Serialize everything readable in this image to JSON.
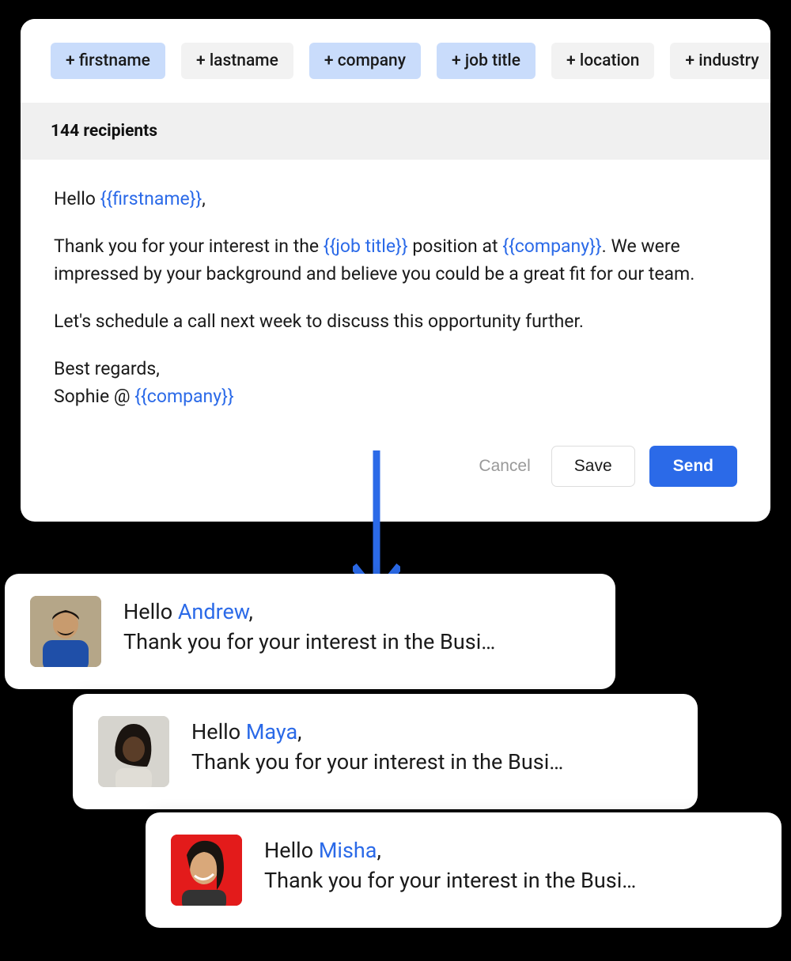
{
  "chips": [
    {
      "label": "+ firstname",
      "active": true
    },
    {
      "label": "+ lastname",
      "active": false
    },
    {
      "label": "+ company",
      "active": true
    },
    {
      "label": "+ job title",
      "active": true
    },
    {
      "label": "+ location",
      "active": false
    },
    {
      "label": "+ industry",
      "active": false
    }
  ],
  "recipients_label": "144 recipients",
  "body": {
    "greeting_prefix": "Hello ",
    "greeting_tag": "{{firstname}}",
    "greeting_suffix": ",",
    "para1_a": "Thank you for your interest in the ",
    "para1_tag1": "{{job title}}",
    "para1_b": " position at ",
    "para1_tag2": "{{company}}",
    "para1_c": ". We were impressed by your background and believe you could be a great fit for our team.",
    "para2": "Let's schedule a call next week to discuss this opportunity further.",
    "signoff_a": "Best regards,",
    "signoff_b": "Sophie @ ",
    "signoff_tag": "{{company}}"
  },
  "actions": {
    "cancel": "Cancel",
    "save": "Save",
    "send": "Send"
  },
  "previews": [
    {
      "greeting_prefix": "Hello ",
      "name": "Andrew",
      "suffix": ",",
      "line2": "Thank you for your interest in the Busi…"
    },
    {
      "greeting_prefix": "Hello ",
      "name": "Maya",
      "suffix": ",",
      "line2": "Thank you for your interest in the Busi…"
    },
    {
      "greeting_prefix": "Hello ",
      "name": "Misha",
      "suffix": ",",
      "line2": "Thank you for your interest in the Busi…"
    }
  ]
}
